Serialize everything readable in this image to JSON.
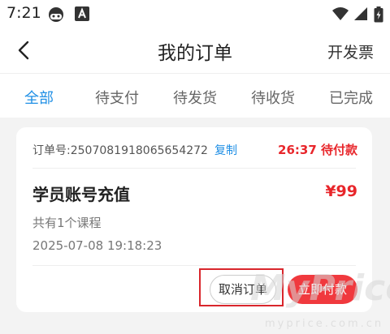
{
  "status_bar": {
    "time": "7:21",
    "icons": [
      "game-controller-icon",
      "app-a-icon",
      "wifi-icon",
      "signal-icon",
      "battery-icon"
    ]
  },
  "header": {
    "title": "我的订单",
    "right_action": "开发票",
    "back_icon": "chevron-left-icon"
  },
  "tabs": [
    {
      "label": "全部",
      "active": true
    },
    {
      "label": "待支付",
      "active": false
    },
    {
      "label": "待发货",
      "active": false
    },
    {
      "label": "待收货",
      "active": false
    },
    {
      "label": "已完成",
      "active": false
    }
  ],
  "order": {
    "order_no_text": "订单号:2507081918065654272",
    "copy_label": "复制",
    "status": "26:37 待付款",
    "product_name": "学员账号充值",
    "price": "¥99",
    "course_count": "共有1个课程",
    "created_at": "2025-07-08 19:18:23",
    "cancel_label": "取消订单",
    "pay_label": "立即付款"
  },
  "watermark": {
    "logo": "MyPrice",
    "url": "myprice.com.cn"
  },
  "colors": {
    "accent_blue": "#1f8fe5",
    "accent_red": "#e8262b",
    "pay_button": "#f0393e",
    "background": "#f3f3f3"
  }
}
